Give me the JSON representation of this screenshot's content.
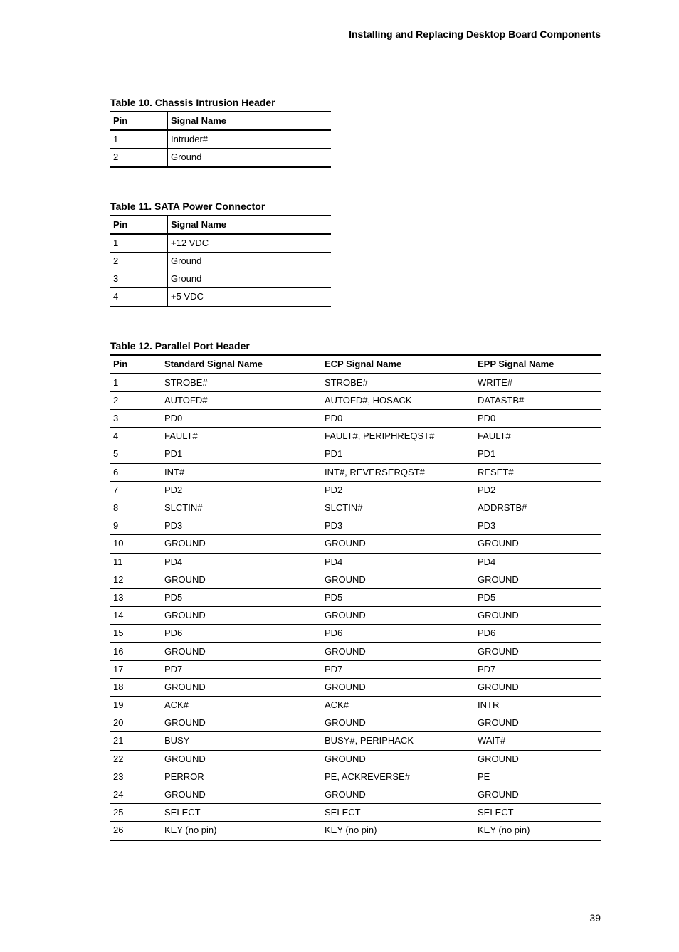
{
  "header": "Installing and Replacing Desktop Board Components",
  "page_number": "39",
  "table10": {
    "caption": "Table 10. Chassis Intrusion Header",
    "headers": [
      "Pin",
      "Signal Name"
    ],
    "rows": [
      [
        "1",
        "Intruder#"
      ],
      [
        "2",
        "Ground"
      ]
    ]
  },
  "table11": {
    "caption": "Table 11. SATA Power Connector",
    "headers": [
      "Pin",
      "Signal Name"
    ],
    "rows": [
      [
        "1",
        "+12 VDC"
      ],
      [
        "2",
        "Ground"
      ],
      [
        "3",
        "Ground"
      ],
      [
        "4",
        "+5 VDC"
      ]
    ]
  },
  "table12": {
    "caption": "Table 12. Parallel Port Header",
    "headers": [
      "Pin",
      "Standard Signal Name",
      "ECP Signal Name",
      "EPP Signal Name"
    ],
    "rows": [
      [
        "1",
        "STROBE#",
        "STROBE#",
        "WRITE#"
      ],
      [
        "2",
        "AUTOFD#",
        "AUTOFD#, HOSACK",
        "DATASTB#"
      ],
      [
        "3",
        "PD0",
        "PD0",
        "PD0"
      ],
      [
        "4",
        "FAULT#",
        "FAULT#, PERIPHREQST#",
        "FAULT#"
      ],
      [
        "5",
        "PD1",
        "PD1",
        "PD1"
      ],
      [
        "6",
        "INT#",
        "INT#, REVERSERQST#",
        "RESET#"
      ],
      [
        "7",
        "PD2",
        "PD2",
        "PD2"
      ],
      [
        "8",
        "SLCTIN#",
        "SLCTIN#",
        "ADDRSTB#"
      ],
      [
        "9",
        "PD3",
        "PD3",
        "PD3"
      ],
      [
        "10",
        "GROUND",
        "GROUND",
        "GROUND"
      ],
      [
        "11",
        "PD4",
        "PD4",
        "PD4"
      ],
      [
        "12",
        "GROUND",
        "GROUND",
        "GROUND"
      ],
      [
        "13",
        "PD5",
        "PD5",
        "PD5"
      ],
      [
        "14",
        "GROUND",
        "GROUND",
        "GROUND"
      ],
      [
        "15",
        "PD6",
        "PD6",
        "PD6"
      ],
      [
        "16",
        "GROUND",
        "GROUND",
        "GROUND"
      ],
      [
        "17",
        "PD7",
        "PD7",
        "PD7"
      ],
      [
        "18",
        "GROUND",
        "GROUND",
        "GROUND"
      ],
      [
        "19",
        "ACK#",
        "ACK#",
        "INTR"
      ],
      [
        "20",
        "GROUND",
        "GROUND",
        "GROUND"
      ],
      [
        "21",
        "BUSY",
        "BUSY#, PERIPHACK",
        "WAIT#"
      ],
      [
        "22",
        "GROUND",
        "GROUND",
        "GROUND"
      ],
      [
        "23",
        "PERROR",
        "PE, ACKREVERSE#",
        "PE"
      ],
      [
        "24",
        "GROUND",
        "GROUND",
        "GROUND"
      ],
      [
        "25",
        "SELECT",
        "SELECT",
        "SELECT"
      ],
      [
        "26",
        "KEY (no pin)",
        "KEY (no pin)",
        "KEY (no pin)"
      ]
    ]
  }
}
